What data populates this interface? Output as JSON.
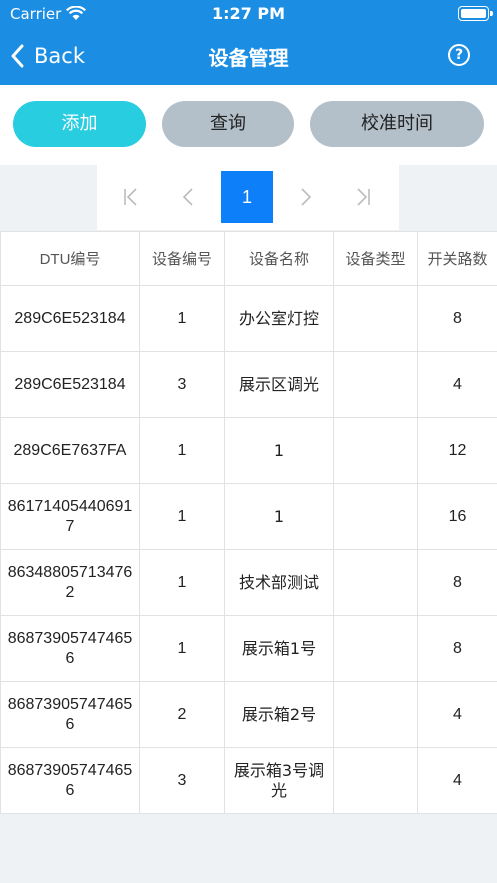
{
  "status_bar": {
    "carrier": "Carrier",
    "time": "1:27 PM"
  },
  "nav": {
    "back_label": "Back",
    "title": "设备管理",
    "help_icon": "question-circle-icon",
    "help_glyph": "?"
  },
  "toolbar": {
    "add_label": "添加",
    "query_label": "查询",
    "calibrate_label": "校准时间"
  },
  "pagination": {
    "current_page": "1"
  },
  "table": {
    "headers": [
      "DTU编号",
      "设备编号",
      "设备名称",
      "设备类型",
      "开关路数"
    ],
    "rows": [
      [
        "289C6E523184",
        "1",
        "办公室灯控",
        "",
        "8"
      ],
      [
        "289C6E523184",
        "3",
        "展示区调光",
        "",
        "4"
      ],
      [
        "289C6E7637FA",
        "1",
        "1",
        "",
        "12"
      ],
      [
        "861714054406917",
        "1",
        "1",
        "",
        "16"
      ],
      [
        "863488057134762",
        "1",
        "技术部测试",
        "",
        "8"
      ],
      [
        "868739057474656",
        "1",
        "展示箱1号",
        "",
        "8"
      ],
      [
        "868739057474656",
        "2",
        "展示箱2号",
        "",
        "4"
      ],
      [
        "868739057474656",
        "3",
        "展示箱3号调光",
        "",
        "4"
      ]
    ]
  },
  "colors": {
    "header_blue": "#1b8ee4",
    "add_button": "#28cde0",
    "gray_button": "#b3c0ca",
    "page_active": "#0d7ff8"
  }
}
